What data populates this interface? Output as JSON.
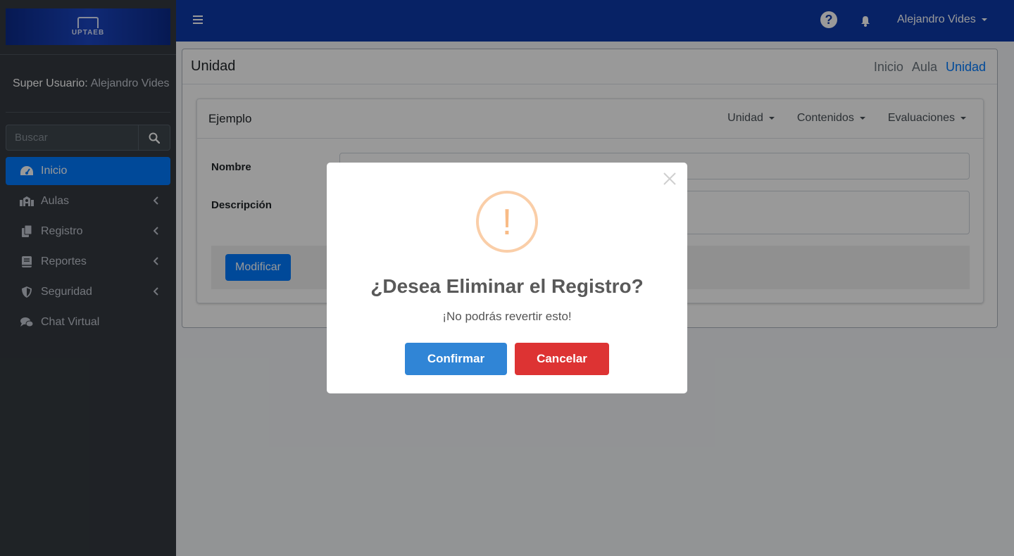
{
  "brand": {
    "logo_text": "UPTAEB"
  },
  "user_panel": {
    "role": "Super Usuario:",
    "name": "Alejandro Vides"
  },
  "search": {
    "placeholder": "Buscar"
  },
  "sidebar": {
    "items": [
      {
        "label": "Inicio",
        "icon": "dashboard-icon",
        "active": true
      },
      {
        "label": "Aulas",
        "icon": "school-icon",
        "has_children": true
      },
      {
        "label": "Registro",
        "icon": "copy-icon",
        "has_children": true
      },
      {
        "label": "Reportes",
        "icon": "book-icon",
        "has_children": true
      },
      {
        "label": "Seguridad",
        "icon": "shield-icon",
        "has_children": true
      },
      {
        "label": "Chat Virtual",
        "icon": "comments-icon"
      }
    ]
  },
  "navbar": {
    "user_name": "Alejandro Vides"
  },
  "page": {
    "title": "Unidad",
    "breadcrumb": [
      "Inicio",
      "Aula",
      "Unidad"
    ]
  },
  "card": {
    "title": "Ejemplo",
    "tabs": [
      "Unidad",
      "Contenidos",
      "Evaluaciones"
    ],
    "form": {
      "nombre_label": "Nombre",
      "descripcion_label": "Descripción"
    },
    "modify_label": "Modificar"
  },
  "modal": {
    "icon": "!",
    "title": "¿Desea Eliminar el Registro?",
    "text": "¡No podrás revertir esto!",
    "confirm_label": "Confirmar",
    "cancel_label": "Cancelar"
  },
  "colors": {
    "navbar": "#0d3aa9",
    "sidebar": "#343a40",
    "active": "#007bff",
    "confirm": "#3085d6",
    "cancel": "#dd3333",
    "warning": "#f8bb86"
  }
}
